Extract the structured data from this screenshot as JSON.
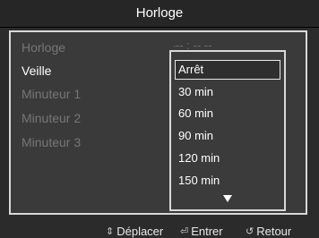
{
  "header": {
    "title": "Horloge"
  },
  "menu": {
    "items": [
      {
        "label": "Horloge",
        "state": "disabled"
      },
      {
        "label": "Veille",
        "state": "active"
      },
      {
        "label": "Minuteur 1",
        "state": "disabled"
      },
      {
        "label": "Minuteur 2",
        "state": "disabled"
      },
      {
        "label": "Minuteur 3",
        "state": "disabled"
      }
    ],
    "separator": ":",
    "horloge_value": "-- : -- --"
  },
  "dropdown": {
    "options": [
      "Arrêt",
      "30 min",
      "60 min",
      "90 min",
      "120 min",
      "150 min"
    ],
    "selected": "Arrêt",
    "more_icon": "triangle-down-icon"
  },
  "footer": {
    "move_label": "Déplacer",
    "enter_label": "Entrer",
    "return_label": "Retour",
    "move_icon": "up-down-arrow-icon",
    "enter_icon": "enter-icon",
    "return_icon": "return-icon"
  },
  "colors": {
    "background": "#2b2b2b",
    "panel": "#3a3a3a",
    "border": "#d8d8d8",
    "dim_text": "#767676"
  }
}
